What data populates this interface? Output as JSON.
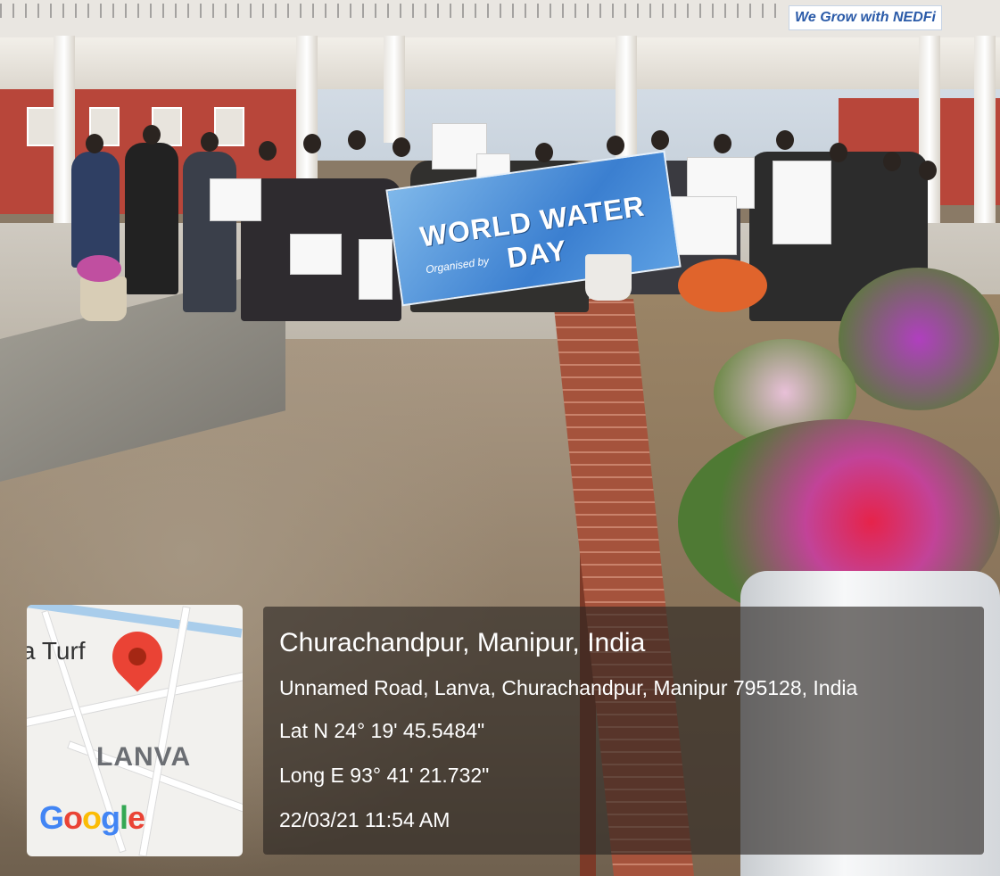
{
  "building": {
    "sign_text": "We Grow with NEDFi"
  },
  "banner": {
    "title": "WORLD WATER DAY",
    "subtitle": "Organised by"
  },
  "map": {
    "place_label": "a Turf",
    "area_label": "LANVA",
    "provider": "Google",
    "pin_icon": "map-pin-icon"
  },
  "location": {
    "title": "Churachandpur, Manipur, India",
    "address": "Unnamed Road, Lanva, Churachandpur, Manipur 795128, India",
    "latitude": "Lat N 24° 19' 45.5484\"",
    "longitude": "Long E 93° 41' 21.732\"",
    "timestamp": "22/03/21 11:54 AM"
  },
  "colors": {
    "google_blue": "#4285f4",
    "google_red": "#ea4335",
    "google_yellow": "#fbbc05",
    "google_green": "#34a853"
  }
}
